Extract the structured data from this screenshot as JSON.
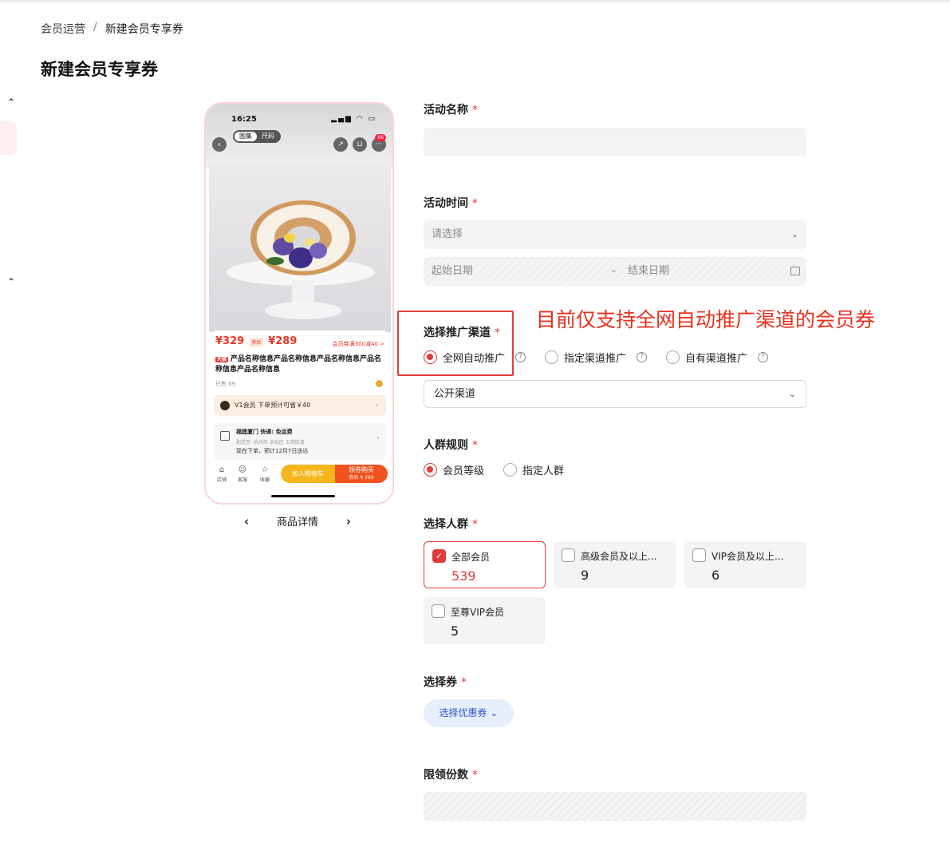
{
  "breadcrumb": {
    "parent": "会员运营",
    "separator": "/",
    "current": "新建会员专享券"
  },
  "page_title": "新建会员专享券",
  "phone_preview": {
    "time": "16:25",
    "status_icons": "▂▄▆ ◠ ▭",
    "tabs": [
      "图集",
      "尺码"
    ],
    "badge_count": "66",
    "price": "¥329",
    "coupon_tag": "券后",
    "price_after": "¥289",
    "coupon_link": "会员券满300减40 >",
    "tmall_tag": "天猫",
    "product_name": "产品名称信息产品名称信息产品名称信息产品名称信息产品名称信息",
    "sold": "已售 69",
    "vip_text": "V1会员 下单预计可省￥40",
    "ship_from": "福建厦门    快递: 免运费",
    "ship_to": "配送至: 杭州市 余杭区 五常街道",
    "ship_eta": "现在下单，预计12月7日送达",
    "bar_items": [
      {
        "icon": "store-icon",
        "label": "店铺"
      },
      {
        "icon": "service-icon",
        "label": "客服"
      },
      {
        "icon": "star-icon",
        "label": "收藏"
      }
    ],
    "add_cart": "加入购物车",
    "buy_label": "领券购买",
    "buy_sub": "券后 ¥ 289",
    "nav_label": "商品详情"
  },
  "form": {
    "activity_name_label": "活动名称",
    "activity_time_label": "活动时间",
    "time_select_placeholder": "请选择",
    "start_date_placeholder": "起始日期",
    "end_date_placeholder": "结束日期",
    "date_separator": "–",
    "channel_label": "选择推广渠道",
    "channel_options": [
      "全网自动推广",
      "指定渠道推广",
      "自有渠道推广"
    ],
    "channel_selected": "全网自动推广",
    "channel_select_value": "公开渠道",
    "annotation": "目前仅支持全网自动推广渠道的会员券",
    "crowd_rule_label": "人群规则",
    "crowd_rule_options": [
      "会员等级",
      "指定人群"
    ],
    "crowd_rule_selected": "会员等级",
    "crowd_label": "选择人群",
    "crowd_cards": [
      {
        "name": "全部会员",
        "count": "539",
        "checked": true
      },
      {
        "name": "高级会员及以上...",
        "count": "9",
        "checked": false
      },
      {
        "name": "VIP会员及以上...",
        "count": "6",
        "checked": false
      },
      {
        "name": "至尊VIP会员",
        "count": "5",
        "checked": false
      }
    ],
    "coupon_label": "选择券",
    "coupon_button": "选择优惠券",
    "limit_label": "限领份数",
    "required_mark": "*"
  },
  "colors": {
    "accent": "#e23b3b",
    "link": "#2f55d4",
    "annotation": "#e8321f"
  }
}
